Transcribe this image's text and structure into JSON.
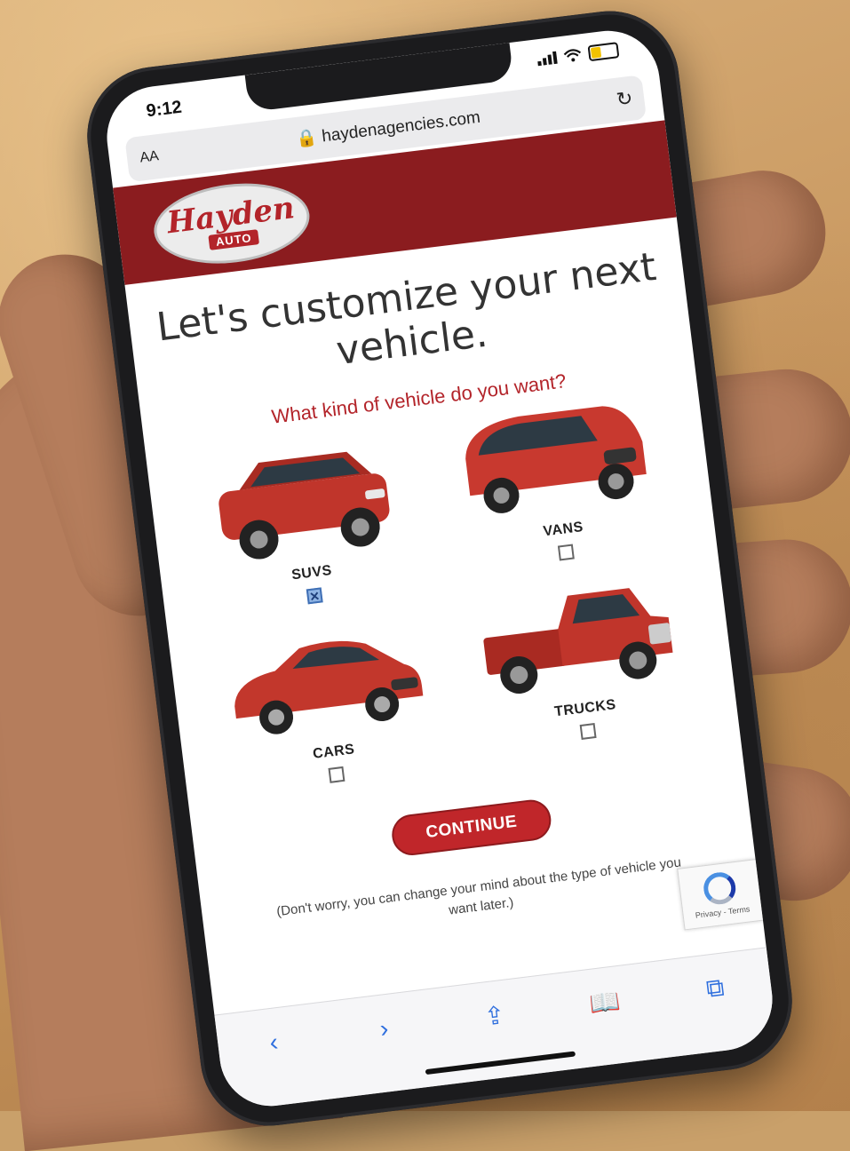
{
  "status": {
    "time": "9:12"
  },
  "browser": {
    "text_size": "AA",
    "url": "haydenagencies.com"
  },
  "logo": {
    "script": "Hayden",
    "auto": "AUTO"
  },
  "headline": "Let's customize your next vehicle.",
  "question": "What kind of vehicle do you want?",
  "vehicle_types": [
    {
      "label": "SUVS",
      "checked": true
    },
    {
      "label": "VANS",
      "checked": false
    },
    {
      "label": "CARS",
      "checked": false
    },
    {
      "label": "TRUCKS",
      "checked": false
    }
  ],
  "continue_label": "CONTINUE",
  "note": "(Don't worry, you can change your mind about the type of vehicle you want later.)",
  "recaptcha": {
    "links": "Privacy - Terms"
  },
  "colors": {
    "brand": "#8b1c1f",
    "accent": "#c0262a",
    "link": "#2f6fde"
  },
  "toolbar_icons": [
    "back-chevron-icon",
    "forward-chevron-icon",
    "share-icon",
    "bookmarks-icon",
    "tabs-icon"
  ]
}
